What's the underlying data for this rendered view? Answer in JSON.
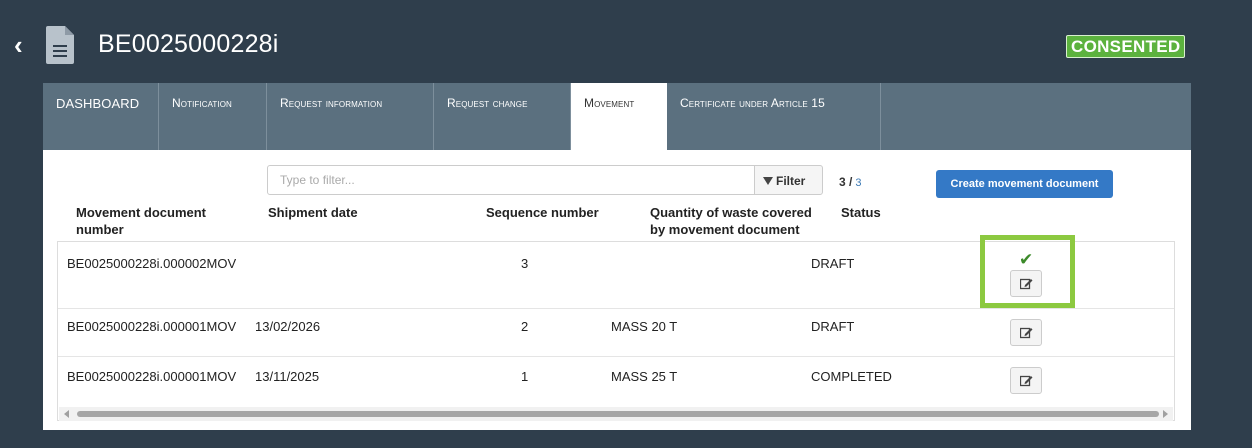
{
  "header": {
    "back_icon": "chevron-left-icon",
    "doc_icon": "document-icon",
    "title": "BE0025000228i",
    "status_badge": "CONSENTED",
    "badge_color": "#5cb23e"
  },
  "tabs": [
    {
      "label": "DASHBOARD",
      "active": false
    },
    {
      "label": "Notification",
      "active": false
    },
    {
      "label": "Request information",
      "active": false
    },
    {
      "label": "Request change",
      "active": false
    },
    {
      "label": "Movement",
      "active": true
    },
    {
      "label": "Certificate under Article 15",
      "active": false
    }
  ],
  "toolbar": {
    "filter_placeholder": "Type to filter...",
    "filter_label": "Filter",
    "count_shown": "3 /",
    "count_total": "3",
    "create_label": "Create movement document",
    "accent_color": "#3479c6"
  },
  "table": {
    "columns": [
      "Movement document number",
      "Shipment date",
      "Sequence number",
      "Quantity of waste covered by movement document",
      "Status"
    ],
    "rows": [
      {
        "doc_number": "BE0025000228i.000002MOV",
        "shipment_date": "",
        "sequence": "3",
        "quantity": "",
        "status": "DRAFT",
        "checked": true
      },
      {
        "doc_number": "BE0025000228i.000001MOV",
        "shipment_date": "13/02/2026",
        "sequence": "2",
        "quantity": "MASS 20 T",
        "status": "DRAFT",
        "checked": false
      },
      {
        "doc_number": "BE0025000228i.000001MOV",
        "shipment_date": "13/11/2025",
        "sequence": "1",
        "quantity": "MASS 25 T",
        "status": "COMPLETED",
        "checked": false
      }
    ],
    "check_icon": "checkmark-icon",
    "edit_icon": "edit-icon",
    "highlight_color": "#8cc940"
  }
}
